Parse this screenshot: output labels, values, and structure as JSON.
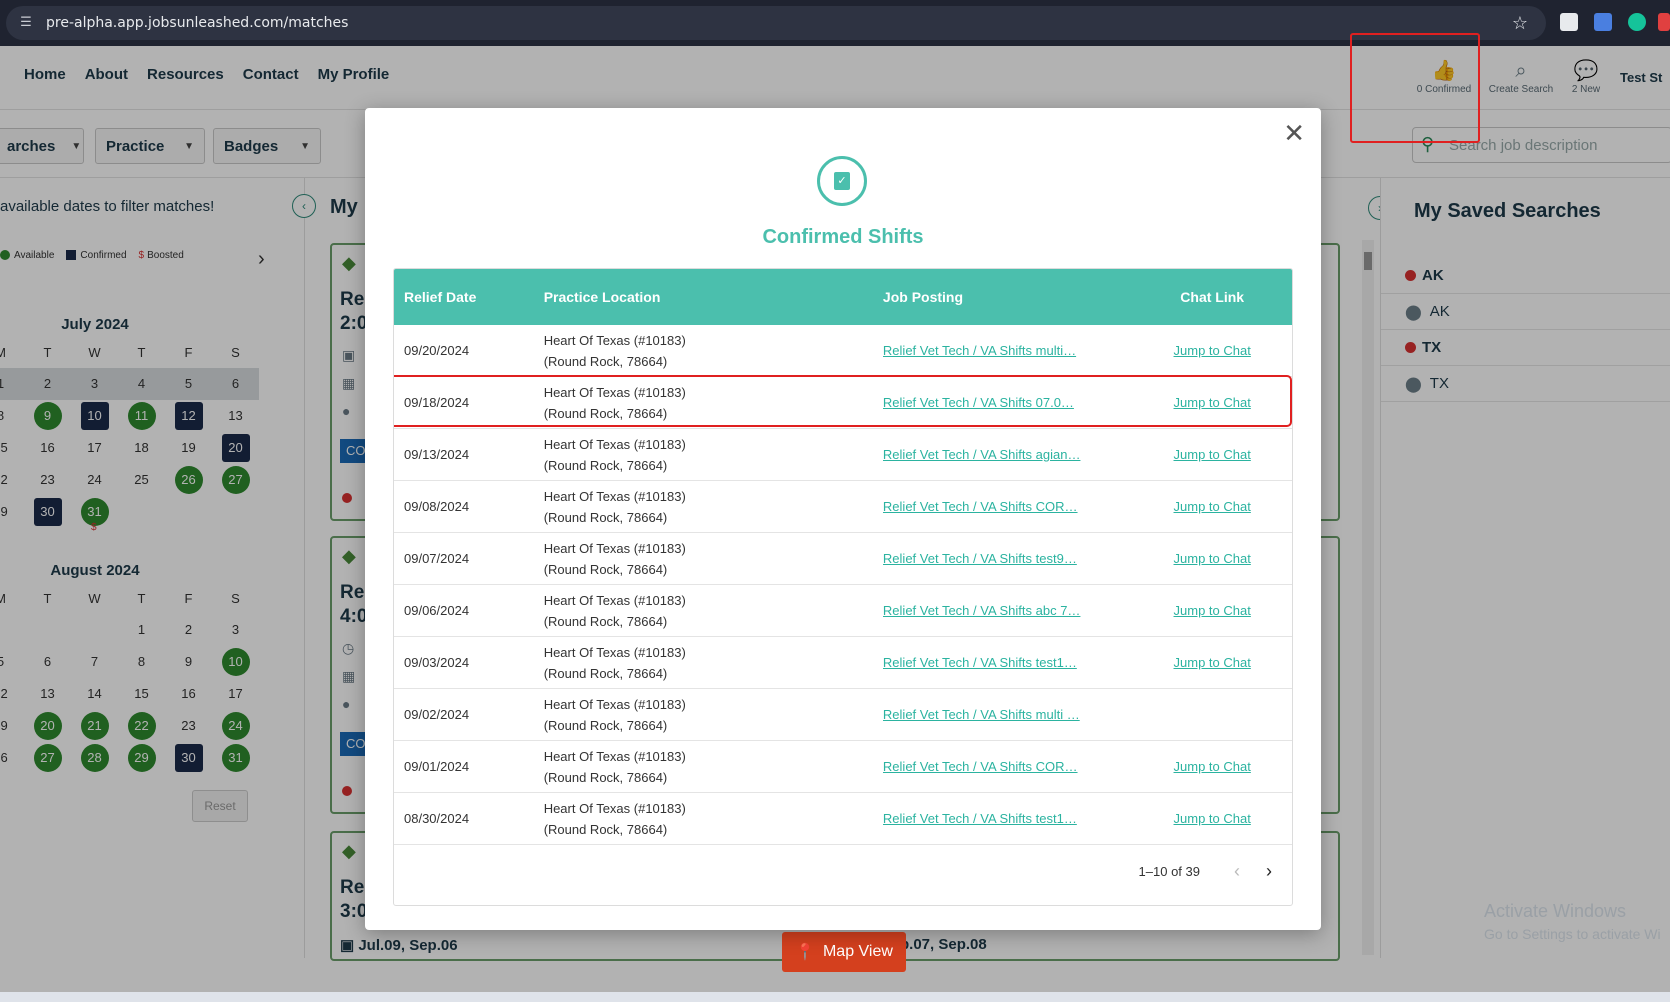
{
  "browser": {
    "url": "pre-alpha.app.jobsunleashed.com/matches"
  },
  "nav": {
    "items": [
      "Home",
      "About",
      "Resources",
      "Contact",
      "My Profile"
    ]
  },
  "header_icons": {
    "confirmed": "0 Confirmed",
    "create_search": "Create Search",
    "new_messages": "2 New",
    "user": "Test St"
  },
  "filters": {
    "searches": "arches",
    "practice": "Practice",
    "badges": "Badges",
    "search_placeholder": "Search job description"
  },
  "calendar": {
    "hint": "available dates to filter matches!",
    "legend": {
      "available": "Available",
      "confirmed": "Confirmed",
      "boosted": "Boosted"
    },
    "weekdays": [
      "M",
      "T",
      "W",
      "T",
      "F",
      "S"
    ],
    "months": [
      {
        "title": "July 2024",
        "rows": [
          [
            {
              "n": "1"
            },
            {
              "n": "2"
            },
            {
              "n": "3"
            },
            {
              "n": "4"
            },
            {
              "n": "5"
            },
            {
              "n": "6"
            }
          ],
          [
            {
              "n": "8"
            },
            {
              "n": "9",
              "s": "av"
            },
            {
              "n": "10",
              "s": "cf"
            },
            {
              "n": "11",
              "s": "av"
            },
            {
              "n": "12",
              "s": "cf"
            },
            {
              "n": "13"
            }
          ],
          [
            {
              "n": "15"
            },
            {
              "n": "16"
            },
            {
              "n": "17"
            },
            {
              "n": "18"
            },
            {
              "n": "19"
            },
            {
              "n": "20",
              "s": "cf"
            }
          ],
          [
            {
              "n": "22"
            },
            {
              "n": "23"
            },
            {
              "n": "24"
            },
            {
              "n": "25"
            },
            {
              "n": "26",
              "s": "av"
            },
            {
              "n": "27",
              "s": "av"
            }
          ],
          [
            {
              "n": "29"
            },
            {
              "n": "30",
              "s": "cf"
            },
            {
              "n": "31",
              "s": "av",
              "boost": "$"
            },
            {
              "n": ""
            },
            {
              "n": ""
            },
            {
              "n": ""
            }
          ]
        ]
      },
      {
        "title": "August 2024",
        "rows": [
          [
            {
              "n": ""
            },
            {
              "n": ""
            },
            {
              "n": ""
            },
            {
              "n": "1"
            },
            {
              "n": "2"
            },
            {
              "n": "3"
            }
          ],
          [
            {
              "n": "5"
            },
            {
              "n": "6"
            },
            {
              "n": "7"
            },
            {
              "n": "8"
            },
            {
              "n": "9"
            },
            {
              "n": "10",
              "s": "av"
            }
          ],
          [
            {
              "n": "12"
            },
            {
              "n": "13"
            },
            {
              "n": "14"
            },
            {
              "n": "15"
            },
            {
              "n": "16"
            },
            {
              "n": "17"
            }
          ],
          [
            {
              "n": "19"
            },
            {
              "n": "20",
              "s": "av"
            },
            {
              "n": "21",
              "s": "av"
            },
            {
              "n": "22",
              "s": "av"
            },
            {
              "n": "23"
            },
            {
              "n": "24",
              "s": "av"
            }
          ],
          [
            {
              "n": "26"
            },
            {
              "n": "27",
              "s": "av"
            },
            {
              "n": "28",
              "s": "av"
            },
            {
              "n": "29",
              "s": "av"
            },
            {
              "n": "30",
              "s": "cf"
            },
            {
              "n": "31",
              "s": "av"
            }
          ]
        ]
      }
    ],
    "reset": "Reset"
  },
  "middle": {
    "title": "My",
    "cards": [
      {
        "title_1": "Re",
        "title_2": "2:0",
        "button": "CO"
      },
      {
        "title_1": "Re",
        "title_2": "4:0",
        "button": "CO"
      },
      {
        "title_1": "Re",
        "title_2": "3:0"
      }
    ],
    "dates_left": "Jul.09, Sep.06",
    "dates_right": "p.07, Sep.08",
    "map_view": "Map View"
  },
  "saved_searches": {
    "title": "My Saved Searches",
    "items": [
      {
        "label": "AK",
        "kind": "state"
      },
      {
        "label": "AK",
        "kind": "location"
      },
      {
        "label": "TX",
        "kind": "state"
      },
      {
        "label": "TX",
        "kind": "location"
      }
    ]
  },
  "watermark": {
    "line1": "Activate Windows",
    "line2": "Go to Settings to activate Wi"
  },
  "modal": {
    "title": "Confirmed Shifts",
    "columns": [
      "Relief Date",
      "Practice Location",
      "Job Posting",
      "Chat Link"
    ],
    "rows": [
      {
        "date": "09/20/2024",
        "loc1": "Heart Of Texas (#10183)",
        "loc2": "(Round Rock, 78664)",
        "job": "Relief Vet Tech / VA Shifts multi…",
        "chat": "Jump to Chat"
      },
      {
        "date": "09/18/2024",
        "loc1": "Heart Of Texas (#10183)",
        "loc2": "(Round Rock, 78664)",
        "job": "Relief Vet Tech / VA Shifts 07.0…",
        "chat": "Jump to Chat"
      },
      {
        "date": "09/13/2024",
        "loc1": "Heart Of Texas (#10183)",
        "loc2": "(Round Rock, 78664)",
        "job": "Relief Vet Tech / VA Shifts agian…",
        "chat": "Jump to Chat"
      },
      {
        "date": "09/08/2024",
        "loc1": "Heart Of Texas (#10183)",
        "loc2": "(Round Rock, 78664)",
        "job": "Relief Vet Tech / VA Shifts COR…",
        "chat": "Jump to Chat"
      },
      {
        "date": "09/07/2024",
        "loc1": "Heart Of Texas (#10183)",
        "loc2": "(Round Rock, 78664)",
        "job": "Relief Vet Tech / VA Shifts test9…",
        "chat": "Jump to Chat"
      },
      {
        "date": "09/06/2024",
        "loc1": "Heart Of Texas (#10183)",
        "loc2": "(Round Rock, 78664)",
        "job": "Relief Vet Tech / VA Shifts abc 7…",
        "chat": "Jump to Chat"
      },
      {
        "date": "09/03/2024",
        "loc1": "Heart Of Texas (#10183)",
        "loc2": "(Round Rock, 78664)",
        "job": "Relief Vet Tech / VA Shifts test1…",
        "chat": "Jump to Chat"
      },
      {
        "date": "09/02/2024",
        "loc1": "Heart Of Texas (#10183)",
        "loc2": "(Round Rock, 78664)",
        "job": "Relief Vet Tech / VA Shifts multi …",
        "chat": ""
      },
      {
        "date": "09/01/2024",
        "loc1": "Heart Of Texas (#10183)",
        "loc2": "(Round Rock, 78664)",
        "job": "Relief Vet Tech / VA Shifts COR…",
        "chat": "Jump to Chat"
      },
      {
        "date": "08/30/2024",
        "loc1": "Heart Of Texas (#10183)",
        "loc2": "(Round Rock, 78664)",
        "job": "Relief Vet Tech / VA Shifts test1…",
        "chat": "Jump to Chat"
      }
    ],
    "pagination": "1–10 of 39"
  },
  "colors": {
    "teal_accent": "#4bbfad",
    "available_green": "#2e8a2e",
    "confirmed_navy": "#1b2a4a",
    "highlight_red": "#e02020",
    "map_button": "#d4401e"
  }
}
